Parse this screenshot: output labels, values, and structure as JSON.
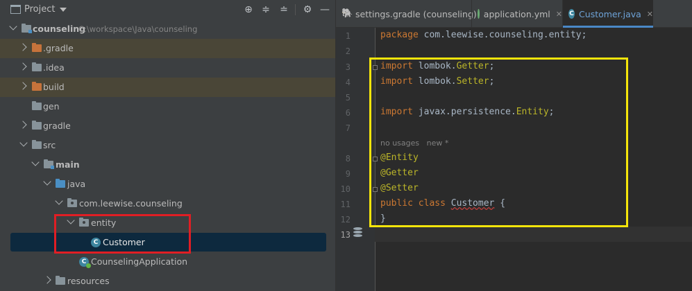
{
  "project_panel": {
    "title": "Project",
    "toolbar_icons": [
      "crosshair-icon",
      "expand-all-icon",
      "collapse-all-icon",
      "gear-icon",
      "minimize-icon"
    ],
    "tree": {
      "root_label": "counseling",
      "root_path": "C:\\workspace\\Java\\counseling",
      "gradle_dir": ".gradle",
      "idea_dir": ".idea",
      "build_dir": "build",
      "gen_dir": "gen",
      "gradle_folder": "gradle",
      "src_dir": "src",
      "main_dir": "main",
      "java_dir": "java",
      "package_name": "com.leewise.counseling",
      "entity_dir": "entity",
      "customer_class": "Customer",
      "app_class": "CounselingApplication",
      "resources_dir": "resources"
    }
  },
  "editor": {
    "tabs": [
      {
        "label": "settings.gradle (counseling)",
        "icon": "gradle-icon"
      },
      {
        "label": "application.yml",
        "icon": "yml-icon"
      },
      {
        "label": "Customer.java",
        "icon": "java-class-icon",
        "active": true
      }
    ],
    "line_numbers": [
      "1",
      "2",
      "3",
      "4",
      "5",
      "6",
      "7",
      "8",
      "9",
      "10",
      "11",
      "12",
      "13"
    ],
    "code": {
      "l1_kw": "package",
      "l1_rest": " com.leewise.counseling.entity;",
      "l3_kw": "import",
      "l3_pkg": " lombok.",
      "l3_cls": "Getter",
      "l3_end": ";",
      "l4_kw": "import",
      "l4_pkg": " lombok.",
      "l4_cls": "Setter",
      "l4_end": ";",
      "l6_kw": "import",
      "l6_pkg": " javax.persistence.",
      "l6_cls": "Entity",
      "l6_end": ";",
      "hint": "no usages   new *",
      "l8": "@Entity",
      "l9": "@Getter",
      "l10": "@Setter",
      "l11_kw": "public class ",
      "l11_name": "Customer",
      "l11_end": " {",
      "l12": "}"
    },
    "current_line": "13"
  }
}
